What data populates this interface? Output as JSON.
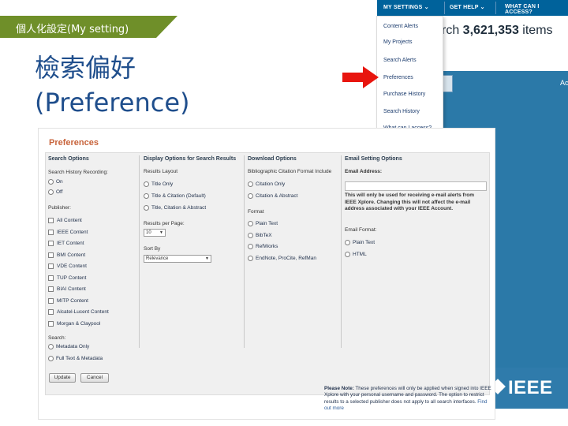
{
  "slide": {
    "ribbon_text": "個人化設定(My setting)",
    "title_line1": "檢索偏好",
    "title_line2": "(Preference)"
  },
  "topbar": {
    "items": [
      "MY SETTINGS",
      "GET HELP",
      "WHAT CAN I ACCESS?"
    ],
    "bg_color": "#00629b"
  },
  "search_count": {
    "prefix": "rch ",
    "count": "3,621,353",
    "suffix": " items"
  },
  "header_cut_text": "Ac",
  "dropdown": {
    "items": [
      "Content Alerts",
      "My Projects",
      "Search Alerts",
      "Preferences",
      "Purchase History",
      "Search History",
      "What can I access?"
    ],
    "highlighted": "Preferences"
  },
  "logo": {
    "text": "IEEE"
  },
  "preferences": {
    "title": "Preferences",
    "title_color": "#c8643c",
    "search_options": {
      "heading": "Search Options",
      "history_label": "Search History Recording:",
      "history_options": [
        "On",
        "Off"
      ],
      "publisher_label": "Publisher:",
      "publishers": [
        "All Content",
        "IEEE Content",
        "IET Content",
        "BMI Content",
        "VDE Content",
        "TUP Content",
        "BIAI Content",
        "MITP Content",
        "Alcatel-Lucent Content",
        "Morgan & Claypool"
      ],
      "search_label": "Search:",
      "search_options": [
        "Metadata Only",
        "Full Text & Metadata"
      ]
    },
    "display_options": {
      "heading": "Display Options for Search Results",
      "layout_label": "Results Layout",
      "layouts": [
        "Title Only",
        "Title & Citation (Default)",
        "Title, Citation & Abstract"
      ],
      "per_page_label": "Results per Page:",
      "per_page_value": "10",
      "sort_label": "Sort By",
      "sort_value": "Relevance"
    },
    "download_options": {
      "heading": "Download Options",
      "citation_label": "Bibliographic Citation Format Include",
      "citation_options": [
        "Citation Only",
        "Citation & Abstract"
      ],
      "format_label": "Format",
      "formats": [
        "Plain Text",
        "BibTeX",
        "RefWorks",
        "EndNote, ProCite, RefMan"
      ]
    },
    "email_options": {
      "heading": "Email Setting Options",
      "address_label": "Email Address:",
      "address_value": "",
      "help_text": "This will only be used for receiving e-mail alerts from IEEE Xplore. Changing this will not affect the e-mail address associated with your IEEE Account.",
      "format_label": "Email Format:",
      "formats": [
        "Plain Text",
        "HTML"
      ]
    },
    "buttons": {
      "update": "Update",
      "cancel": "Cancel"
    },
    "note": {
      "bold": "Please Note:",
      "text": " These preferences will only be applied when signed into IEEE Xplore with your personal username and password. The option to restrict results to a selected publisher does not apply to all search interfaces.",
      "link": "Find out more"
    }
  }
}
